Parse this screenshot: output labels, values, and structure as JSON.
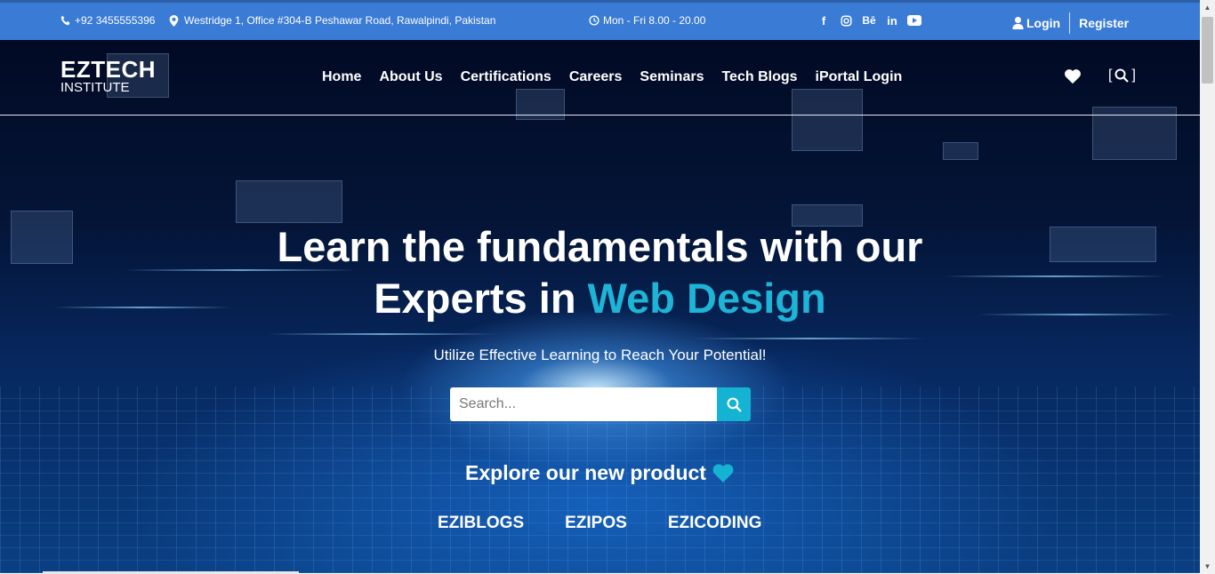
{
  "topbar": {
    "phone": "+92 3455555396",
    "address": "Westridge 1, Office #304-B Peshawar Road, Rawalpindi, Pakistan",
    "hours": "Mon - Fri 8.00 - 20.00",
    "social_icons": [
      "facebook-icon",
      "instagram-icon",
      "behance-icon",
      "linkedin-icon",
      "youtube-icon"
    ],
    "login_label": "Login",
    "register_label": "Register"
  },
  "logo": {
    "line1": "EZTECH",
    "line2": "INSTITUTE"
  },
  "nav": {
    "items": [
      "Home",
      "About Us",
      "Certifications",
      "Careers",
      "Seminars",
      "Tech Blogs",
      "iPortal Login"
    ],
    "search_open": "[",
    "search_close": "]"
  },
  "hero": {
    "headline_line1": "Learn the fundamentals with our",
    "headline_line2_prefix": "Experts in ",
    "headline_highlight": "Web Design",
    "tagline": "Utilize Effective Learning to Reach Your Potential!",
    "search_placeholder": "Search...",
    "explore_label": "Explore our new product",
    "products": [
      "EZIBLOGS",
      "EZIPOS",
      "EZICODING"
    ]
  },
  "colors": {
    "topbar_bg": "#3a7bd5",
    "accent": "#14b3d3",
    "highlight_text": "#1db4d6"
  }
}
